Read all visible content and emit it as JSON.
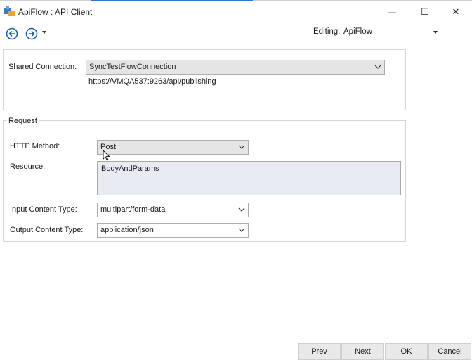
{
  "window": {
    "title": "ApiFlow : API Client",
    "minimize_glyph": "—",
    "maximize_glyph": "☐",
    "close_glyph": "✕"
  },
  "toolbar": {
    "back_icon": "circle-arrow-left-icon",
    "forward_icon": "circle-arrow-right-icon",
    "editing_label": "Editing:",
    "editing_value": "ApiFlow"
  },
  "connection": {
    "label": "Shared Connection:",
    "value": "SyncTestFlowConnection",
    "url": "https://VMQA537:9263/api/publishing"
  },
  "request": {
    "group_label": "Request",
    "http_method_label": "HTTP Method:",
    "http_method_value": "Post",
    "resource_label": "Resource:",
    "resource_value": "BodyAndParams",
    "input_content_type_label": "Input Content Type:",
    "input_content_type_value": "multipart/form-data",
    "output_content_type_label": "Output Content Type:",
    "output_content_type_value": "application/json"
  },
  "footer": {
    "prev_label": "Prev",
    "next_label": "Next",
    "ok_label": "OK",
    "cancel_label": "Cancel"
  },
  "colors": {
    "accent": "#2b78d6",
    "nav_icon": "#1f5fa8",
    "resource_bg": "#e8ebf1"
  }
}
